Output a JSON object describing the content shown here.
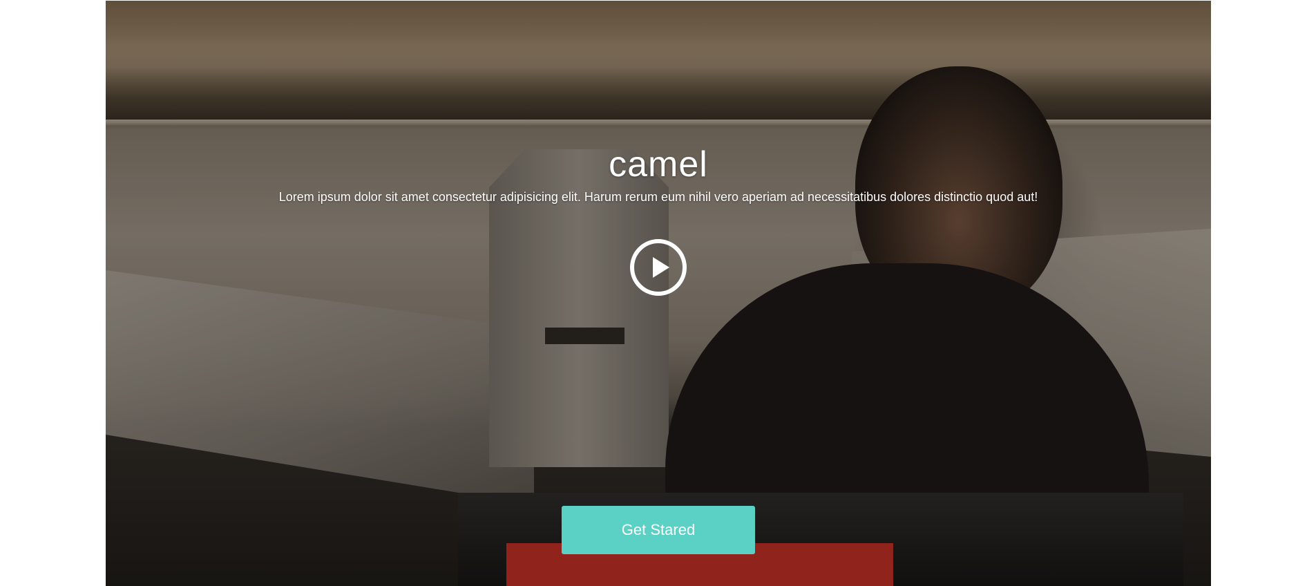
{
  "hero": {
    "title": "camel",
    "subtitle": "Lorem ipsum dolor sit amet consectetur adipisicing elit. Harum rerum eum nihil vero aperiam ad necessitatibus dolores distinctio quod aut!",
    "play_icon": "play-circle-icon",
    "cta_label": "Get Stared"
  },
  "colors": {
    "accent": "#5bd1c6",
    "text": "#ffffff",
    "page_background": "#ffffff"
  }
}
